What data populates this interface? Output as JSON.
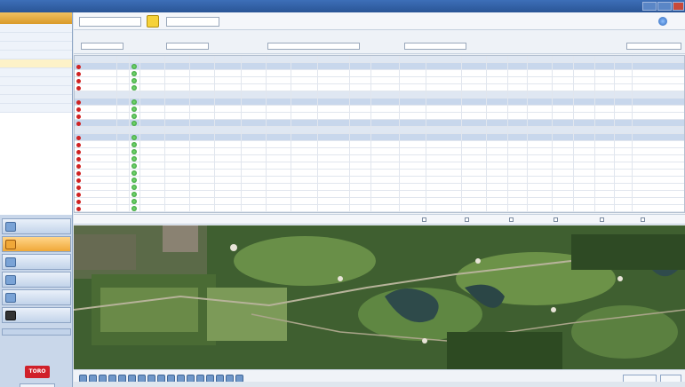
{
  "window": {
    "title": ""
  },
  "sidebar": {
    "header": "",
    "items": [
      "",
      "",
      "",
      "",
      "",
      "",
      "",
      "",
      "",
      ""
    ],
    "nav_buttons": [
      "",
      "",
      "",
      "",
      "",
      ""
    ],
    "brand": "TORO",
    "footer": ""
  },
  "toolbar": {
    "search_placeholder": "",
    "action_label": ""
  },
  "filters": {
    "labels": [
      "",
      "",
      "",
      ""
    ],
    "values": [
      "",
      "",
      "",
      "",
      ""
    ]
  },
  "grid": {
    "rows": 22
  },
  "statusline": {
    "message": "",
    "checks": [
      "",
      "",
      "",
      "",
      "",
      ""
    ]
  },
  "maptools": {
    "close_label": "",
    "close2_label": ""
  },
  "colors": {
    "accent": "#f0a838",
    "title_bar": "#2a5596",
    "status_green": "#238c24",
    "status_red": "#d02222"
  }
}
